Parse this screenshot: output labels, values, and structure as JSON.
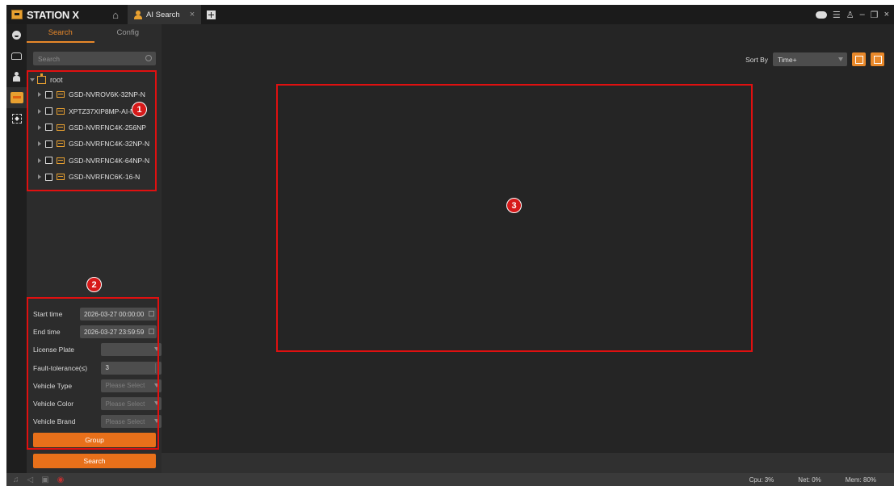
{
  "app": {
    "brand": "STATION X",
    "tab_label": "AI Search",
    "tab_close": "×"
  },
  "rail": {
    "items": [
      "face-icon",
      "car-icon",
      "person-icon",
      "vehicle-search-icon",
      "target-icon"
    ],
    "active_index": 3
  },
  "panel": {
    "tabs": [
      "Search",
      "Config"
    ],
    "active_tab": "Search",
    "search_placeholder": "Search",
    "tree": {
      "root": "root",
      "devices": [
        "GSD-NVROV6K-32NP-N",
        "XPTZ37XIP8MP-AI-N",
        "GSD-NVRFNC4K-256NP",
        "GSD-NVRFNC4K-32NP-N",
        "GSD-NVRFNC4K-64NP-N",
        "GSD-NVRFNC6K-16-N"
      ]
    },
    "form": {
      "start_label": "Start time",
      "start_value": "2026-03-27 00:00:00",
      "end_label": "End time",
      "end_value": "2026-03-27 23:59:59",
      "plate_label": "License Plate",
      "plate_value": "",
      "fault_label": "Fault-tolerance(≤)",
      "fault_value": "3",
      "type_label": "Vehicle Type",
      "type_value": "Please Select",
      "color_label": "Vehicle Color",
      "color_value": "Please Select",
      "brand_label": "Vehicle Brand",
      "brand_value": "Please Select",
      "group_button": "Group",
      "search_button": "Search"
    }
  },
  "main": {
    "sort_label": "Sort By",
    "sort_value": "Time+"
  },
  "status": {
    "cpu": "Cpu: 3%",
    "net": "Net: 0%",
    "mem": "Mem: 80%"
  },
  "annotations": {
    "badge1": "1",
    "badge2": "2",
    "badge3": "3"
  },
  "colors": {
    "accent": "#e8882a",
    "annotation": "#e01010",
    "background": "#262626"
  }
}
